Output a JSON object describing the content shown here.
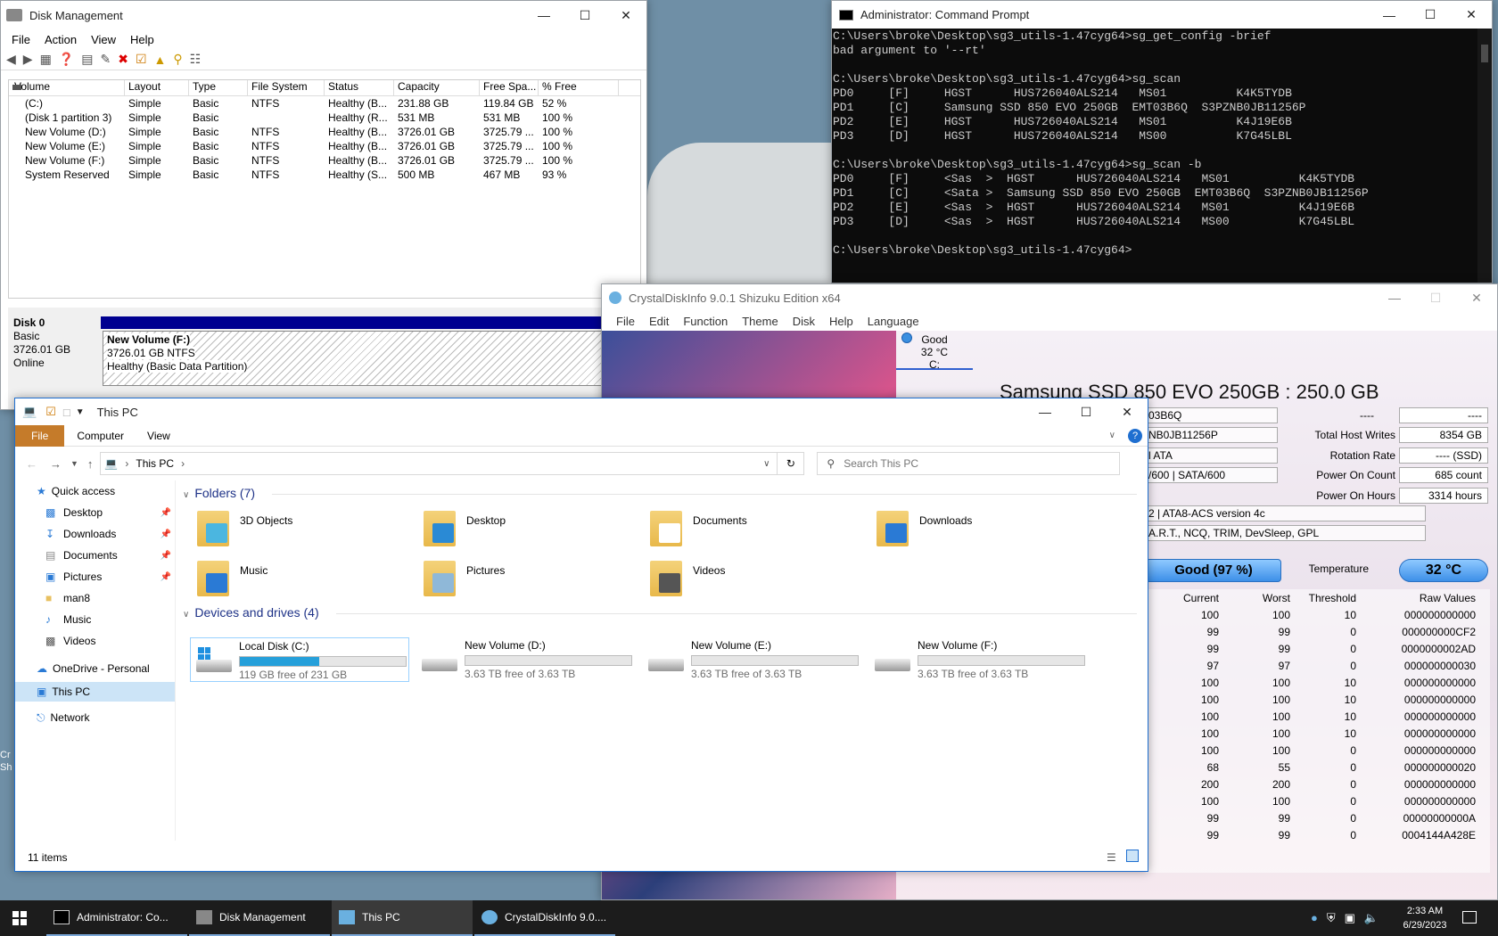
{
  "desktop": {
    "edge_text": "Cr\nSh"
  },
  "dm": {
    "title": "Disk Management",
    "menu": [
      "File",
      "Action",
      "View",
      "Help"
    ],
    "columns": [
      "Volume",
      "Layout",
      "Type",
      "File System",
      "Status",
      "Capacity",
      "Free Spa...",
      "% Free"
    ],
    "rows": [
      [
        "(C:)",
        "Simple",
        "Basic",
        "NTFS",
        "Healthy (B...",
        "231.88 GB",
        "119.84 GB",
        "52 %"
      ],
      [
        "(Disk 1 partition 3)",
        "Simple",
        "Basic",
        "",
        "Healthy (R...",
        "531 MB",
        "531 MB",
        "100 %"
      ],
      [
        "New Volume (D:)",
        "Simple",
        "Basic",
        "NTFS",
        "Healthy (B...",
        "3726.01 GB",
        "3725.79 ...",
        "100 %"
      ],
      [
        "New Volume (E:)",
        "Simple",
        "Basic",
        "NTFS",
        "Healthy (B...",
        "3726.01 GB",
        "3725.79 ...",
        "100 %"
      ],
      [
        "New Volume (F:)",
        "Simple",
        "Basic",
        "NTFS",
        "Healthy (B...",
        "3726.01 GB",
        "3725.79 ...",
        "100 %"
      ],
      [
        "System Reserved",
        "Simple",
        "Basic",
        "NTFS",
        "Healthy (S...",
        "500 MB",
        "467 MB",
        "93 %"
      ]
    ],
    "disk0": {
      "name": "Disk 0",
      "type": "Basic",
      "size": "3726.01 GB",
      "status": "Online",
      "part_name": "New Volume  (F:)",
      "part_size": "3726.01 GB NTFS",
      "part_status": "Healthy (Basic Data Partition)"
    }
  },
  "cmd": {
    "title": "Administrator: Command Prompt",
    "lines": [
      "C:\\Users\\broke\\Desktop\\sg3_utils-1.47cyg64>sg_get_config -brief",
      "bad argument to '--rt'",
      "",
      "C:\\Users\\broke\\Desktop\\sg3_utils-1.47cyg64>sg_scan",
      "PD0     [F]     HGST      HUS726040ALS214   MS01          K4K5TYDB",
      "PD1     [C]     Samsung SSD 850 EVO 250GB  EMT03B6Q  S3PZNB0JB11256P",
      "PD2     [E]     HGST      HUS726040ALS214   MS01          K4J19E6B",
      "PD3     [D]     HGST      HUS726040ALS214   MS00          K7G45LBL",
      "",
      "C:\\Users\\broke\\Desktop\\sg3_utils-1.47cyg64>sg_scan -b",
      "PD0     [F]     <Sas  >  HGST      HUS726040ALS214   MS01          K4K5TYDB",
      "PD1     [C]     <Sata >  Samsung SSD 850 EVO 250GB  EMT03B6Q  S3PZNB0JB11256P",
      "PD2     [E]     <Sas  >  HGST      HUS726040ALS214   MS01          K4J19E6B",
      "PD3     [D]     <Sas  >  HGST      HUS726040ALS214   MS00          K7G45LBL",
      "",
      "C:\\Users\\broke\\Desktop\\sg3_utils-1.47cyg64>"
    ]
  },
  "cdi": {
    "title": "CrystalDiskInfo 9.0.1 Shizuku Edition x64",
    "menu": [
      "File",
      "Edit",
      "Function",
      "Theme",
      "Disk",
      "Help",
      "Language"
    ],
    "disk_status": "Good",
    "disk_temp": "32 °C",
    "disk_letter": "C:",
    "model": "Samsung SSD 850 EVO 250GB : 250.0 GB",
    "left_frag": [
      "03B6Q",
      "NB0JB11256P",
      "l ATA",
      "/600 | SATA/600",
      "2 | ATA8-ACS version 4c",
      "A.R.T., NCQ, TRIM, DevSleep, GPL"
    ],
    "blank_label": "----",
    "blank_value": "----",
    "info_labels": [
      "Total Host Writes",
      "Rotation Rate",
      "Power On Count",
      "Power On Hours"
    ],
    "info_values": [
      "8354 GB",
      "---- (SSD)",
      "685 count",
      "3314 hours"
    ],
    "health": "Good  (97 %)",
    "temp_label": "Temperature",
    "temp_value": "32 °C",
    "smart_headers": [
      "Current",
      "Worst",
      "Threshold",
      "Raw Values"
    ],
    "smart": [
      [
        "100",
        "100",
        "10",
        "000000000000"
      ],
      [
        "99",
        "99",
        "0",
        "000000000CF2"
      ],
      [
        "99",
        "99",
        "0",
        "0000000002AD"
      ],
      [
        "97",
        "97",
        "0",
        "000000000030"
      ],
      [
        "100",
        "100",
        "10",
        "000000000000"
      ],
      [
        "100",
        "100",
        "10",
        "000000000000"
      ],
      [
        "100",
        "100",
        "10",
        "000000000000"
      ],
      [
        "100",
        "100",
        "10",
        "000000000000"
      ],
      [
        "100",
        "100",
        "0",
        "000000000000"
      ],
      [
        "68",
        "55",
        "0",
        "000000000020"
      ],
      [
        "200",
        "200",
        "0",
        "000000000000"
      ],
      [
        "100",
        "100",
        "0",
        "000000000000"
      ],
      [
        "99",
        "99",
        "0",
        "00000000000A"
      ],
      [
        "99",
        "99",
        "0",
        "0004144A428E"
      ]
    ]
  },
  "explorer": {
    "title": "This PC",
    "ribbon_tabs": [
      "File",
      "Computer",
      "View"
    ],
    "address": "This PC",
    "search_placeholder": "Search This PC",
    "nav": {
      "quick_access": "Quick access",
      "items": [
        "Desktop",
        "Downloads",
        "Documents",
        "Pictures",
        "man8",
        "Music",
        "Videos"
      ],
      "onedrive": "OneDrive - Personal",
      "thispc": "This PC",
      "network": "Network"
    },
    "folders_header": "Folders (7)",
    "folders": [
      "3D Objects",
      "Desktop",
      "Documents",
      "Downloads",
      "Music",
      "Pictures",
      "Videos"
    ],
    "drives_header": "Devices and drives (4)",
    "drives": [
      {
        "name": "Local Disk (C:)",
        "free": "119 GB free of 231 GB",
        "used_fraction": 0.48
      },
      {
        "name": "New Volume (D:)",
        "free": "3.63 TB free of 3.63 TB",
        "used_fraction": 0
      },
      {
        "name": "New Volume (E:)",
        "free": "3.63 TB free of 3.63 TB",
        "used_fraction": 0
      },
      {
        "name": "New Volume (F:)",
        "free": "3.63 TB free of 3.63 TB",
        "used_fraction": 0
      }
    ],
    "status": "11 items"
  },
  "taskbar": {
    "items": [
      "Administrator: Co...",
      "Disk Management",
      "This PC",
      "CrystalDiskInfo 9.0...."
    ],
    "time": "2:33 AM",
    "date": "6/29/2023"
  }
}
